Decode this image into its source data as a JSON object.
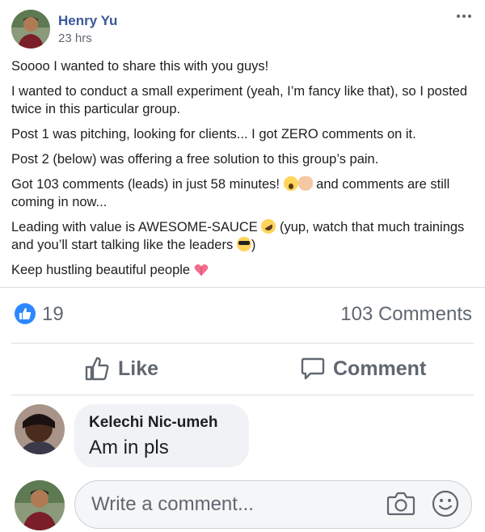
{
  "post": {
    "author": "Henry Yu",
    "timestamp": "23 hrs",
    "paragraphs": [
      "Soooo I wanted to share this with you guys!",
      "I wanted to conduct a small experiment (yeah, I’m fancy like that), so I posted twice in this particular group.",
      "Post 1 was pitching, looking for clients... I got ZERO comments on it.",
      "Post 2 (below) was offering a free solution to this group’s pain."
    ],
    "p5_before": "Got 103 comments (leads) in just 58 minutes!",
    "p5_after": "and comments are still coming in now...",
    "p6_part1": "Leading with value is AWESOME-SAUCE",
    "p6_part2": "(yup, watch that much trainings and you’ll start talking like the leaders",
    "p6_part3": ")",
    "p7": "Keep hustling beautiful people"
  },
  "stats": {
    "likes": "19",
    "comments": "103 Comments"
  },
  "actions": {
    "like_label": "Like",
    "comment_label": "Comment"
  },
  "comments": [
    {
      "name": "Kelechi Nic-umeh",
      "text": "Am in pls"
    }
  ],
  "composer": {
    "placeholder": "Write a comment..."
  },
  "icons": {
    "more": "more-options-icon",
    "like_badge": "thumbs-up-icon",
    "like": "thumbs-up-outline-icon",
    "comment": "speech-bubble-icon",
    "camera": "camera-icon",
    "emoji": "smiley-icon"
  },
  "colors": {
    "author_link": "#385898",
    "like_blue": "#2d88ff",
    "secondary_text": "#606770",
    "bubble_bg": "#f0f2f5"
  }
}
